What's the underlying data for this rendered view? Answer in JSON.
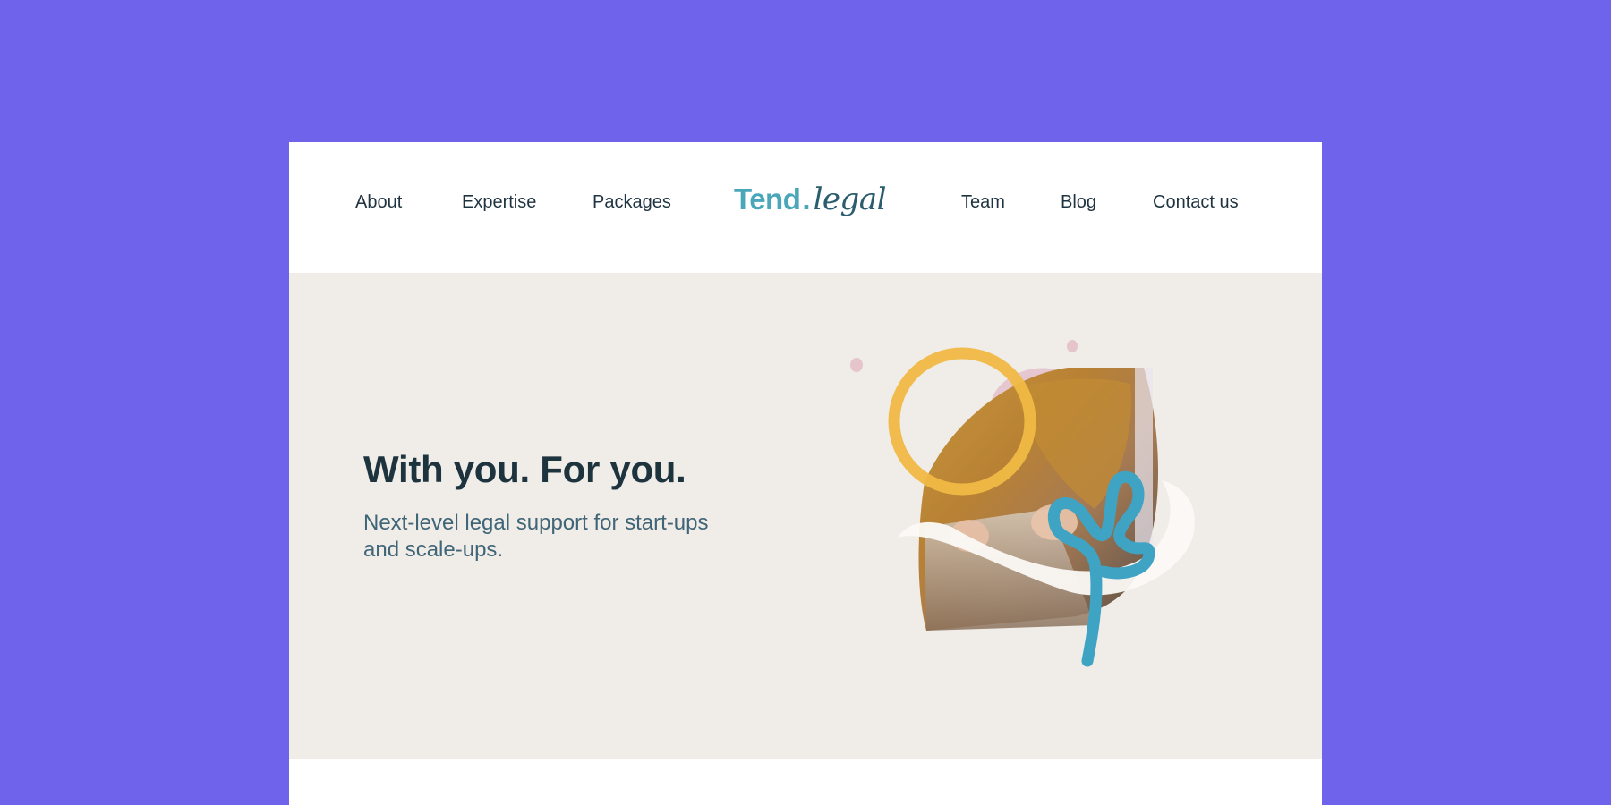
{
  "nav": {
    "left_links": [
      "About",
      "Expertise",
      "Packages"
    ],
    "right_links": [
      "Team",
      "Blog",
      "Contact us"
    ],
    "logo": {
      "primary": "Tend",
      "separator": ".",
      "secondary": "legal"
    }
  },
  "hero": {
    "title": "With you. For you.",
    "subtitle": "Next-level legal support for start-ups and scale-ups."
  },
  "colors": {
    "backdrop": "#6f63ec",
    "hero_background": "#f0ece8",
    "accent_teal": "#4aa7ba",
    "heading": "#1d333d",
    "subheading": "#3f6577",
    "ring_yellow": "#f0b944",
    "squiggle_blue": "#3fa3c3"
  }
}
